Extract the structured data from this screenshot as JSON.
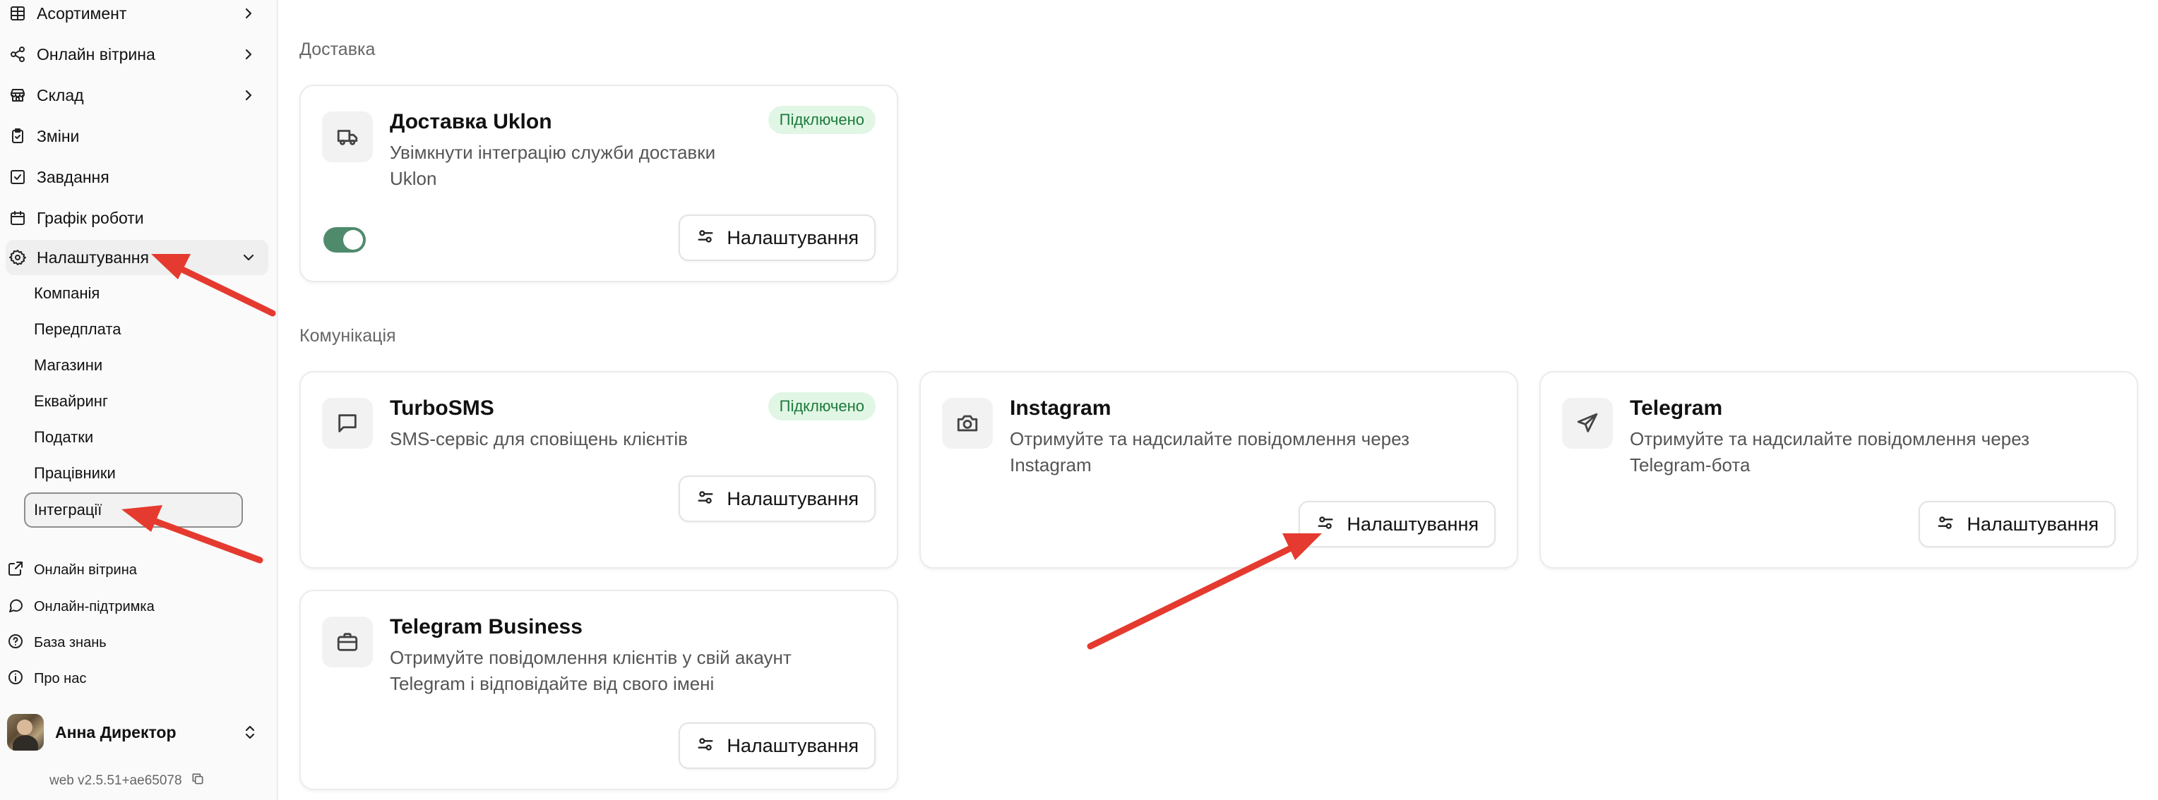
{
  "sidebar": {
    "items": [
      {
        "label": "Асортимент",
        "icon": "table-icon",
        "chevron": "right"
      },
      {
        "label": "Онлайн вітрина",
        "icon": "share-icon",
        "chevron": "right"
      },
      {
        "label": "Склад",
        "icon": "store-icon",
        "chevron": "right"
      },
      {
        "label": "Зміни",
        "icon": "clipboard-check-icon"
      },
      {
        "label": "Завдання",
        "icon": "square-check-icon"
      },
      {
        "label": "Графік роботи",
        "icon": "calendar-icon"
      },
      {
        "label": "Налаштування",
        "icon": "gear-icon",
        "chevron": "down",
        "active": true
      }
    ],
    "settings_sub": [
      "Компанія",
      "Передплата",
      "Магазини",
      "Еквайринг",
      "Податки",
      "Працівники",
      "Інтеграції"
    ],
    "footer": [
      {
        "label": "Онлайн вітрина",
        "icon": "external-link-icon"
      },
      {
        "label": "Онлайн-підтримка",
        "icon": "chat-bubble-icon"
      },
      {
        "label": "База знань",
        "icon": "help-circle-icon"
      },
      {
        "label": "Про нас",
        "icon": "info-circle-icon"
      }
    ],
    "user": {
      "name": "Анна Директор"
    },
    "version": "web v2.5.51+ae65078"
  },
  "main": {
    "sections": [
      {
        "title": "Доставка"
      },
      {
        "title": "Комунікація"
      }
    ],
    "cards": [
      {
        "title": "Доставка Uklon",
        "description": "Увімкнути інтеграцію служби доставки Uklon",
        "badge": "Підключено",
        "button": "Налаштування",
        "icon": "truck-icon",
        "toggle_on": true
      },
      {
        "title": "TurboSMS",
        "description": "SMS-сервіс для сповіщень клієнтів",
        "badge": "Підключено",
        "button": "Налаштування",
        "icon": "message-square-icon"
      },
      {
        "title": "Instagram",
        "description": "Отримуйте та надсилайте повідомлення через Instagram",
        "button": "Налаштування",
        "icon": "camera-icon"
      },
      {
        "title": "Telegram",
        "description": "Отримуйте та надсилайте повідомлення через Telegram-бота",
        "button": "Налаштування",
        "icon": "send-icon"
      },
      {
        "title": "Telegram Business",
        "description": "Отримуйте повідомлення клієнтів у свій акаунт Telegram і відповідайте від свого імені",
        "button": "Налаштування",
        "icon": "briefcase-icon"
      }
    ]
  },
  "colors": {
    "accent": "#4f8a6c",
    "badge_bg": "#e1f6e5",
    "badge_text": "#1c7a3c",
    "annotation_arrow": "#e53a2f"
  }
}
